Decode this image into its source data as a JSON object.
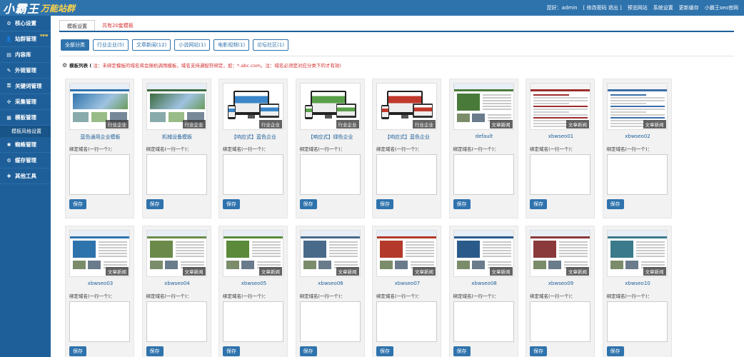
{
  "header": {
    "logo_main": "小霸王",
    "logo_sub": "万能站群",
    "user": "您好：admin",
    "links": [
      "[ 修改密码 退出 ]",
      "预览网站",
      "系统设置",
      "更新缓存",
      "小霸王seo官网"
    ]
  },
  "sidebar": {
    "items": [
      {
        "label": "核心设置",
        "icon": "gear-icon",
        "glyph": "⚙"
      },
      {
        "label": "站群管理",
        "icon": "user-icon",
        "glyph": "👤",
        "badge": "new"
      },
      {
        "label": "内容库",
        "icon": "doc-icon",
        "glyph": "▤"
      },
      {
        "label": "外链管理",
        "icon": "chain-icon",
        "glyph": "✎"
      },
      {
        "label": "关键词管理",
        "icon": "key-icon",
        "glyph": "⚿"
      },
      {
        "label": "采集管理",
        "icon": "collect-icon",
        "glyph": "✣"
      },
      {
        "label": "模板管理",
        "icon": "template-icon",
        "glyph": "▦"
      }
    ],
    "sub_item": "模板风格设置",
    "items_after": [
      {
        "label": "蜘蛛管理",
        "icon": "spider-icon",
        "glyph": "✱"
      },
      {
        "label": "缓存管理",
        "icon": "cache-icon",
        "glyph": "⚙"
      },
      {
        "label": "其他工具",
        "icon": "tools-icon",
        "glyph": "✚"
      }
    ]
  },
  "tabs": {
    "active": "模板设置",
    "count": "共有20套模板"
  },
  "filters": [
    "全部分类",
    "行业企业(5)",
    "文章新闻(12)",
    "小说网站(1)",
    "电影视频(1)",
    "论坛社区(1)"
  ],
  "tip": {
    "label": "模板列表 (",
    "text": "注：未绑定模板的域名将会随机调用模板，域名支持通配符绑定，如：*.abc.com。注：域名必须是对应分类下的才有效)"
  },
  "card_common": {
    "bind_label": "绑定域名(一行一个)：",
    "save_label": "保存"
  },
  "templates": [
    {
      "name": "蓝色通用企业模板",
      "badge": "行业企业",
      "style": "corp",
      "accent": "#2f73ad"
    },
    {
      "name": "机械设备模板",
      "badge": "行业企业",
      "style": "machine",
      "accent": "#3d6b40"
    },
    {
      "name": "【响应式】蓝色企业",
      "badge": "行业企业",
      "style": "responsive",
      "accent": "#3a86c8"
    },
    {
      "name": "【响应式】绿色企业",
      "badge": "行业企业",
      "style": "responsive",
      "accent": "#5aa04a"
    },
    {
      "name": "【响应式】蓝色企业",
      "badge": "行业企业",
      "style": "responsive",
      "accent": "#c0392b"
    },
    {
      "name": "default",
      "badge": "文章新闻",
      "style": "news",
      "accent": "#4a7a3a"
    },
    {
      "name": "xbwseo01",
      "badge": "文章新闻",
      "style": "list",
      "accent": "#9b2c2c"
    },
    {
      "name": "xbwseo02",
      "badge": "文章新闻",
      "style": "list",
      "accent": "#3a6ea8"
    },
    {
      "name": "xbwseo03",
      "badge": "文章新闻",
      "style": "news",
      "accent": "#2f73ad"
    },
    {
      "name": "xbwseo04",
      "badge": "文章新闻",
      "style": "news",
      "accent": "#6b8a4a"
    },
    {
      "name": "xbwseo05",
      "badge": "文章新闻",
      "style": "news",
      "accent": "#5a8a3a"
    },
    {
      "name": "xbwseo06",
      "badge": "文章新闻",
      "style": "news",
      "accent": "#4a6a8a"
    },
    {
      "name": "xbwseo07",
      "badge": "文章新闻",
      "style": "news",
      "accent": "#b33a2a"
    },
    {
      "name": "xbwseo08",
      "badge": "文章新闻",
      "style": "news",
      "accent": "#2a5a8a"
    },
    {
      "name": "xbwseo09",
      "badge": "文章新闻",
      "style": "news",
      "accent": "#8a3a3a"
    },
    {
      "name": "xbwseo10",
      "badge": "文章新闻",
      "style": "news",
      "accent": "#3a7a8a"
    }
  ]
}
